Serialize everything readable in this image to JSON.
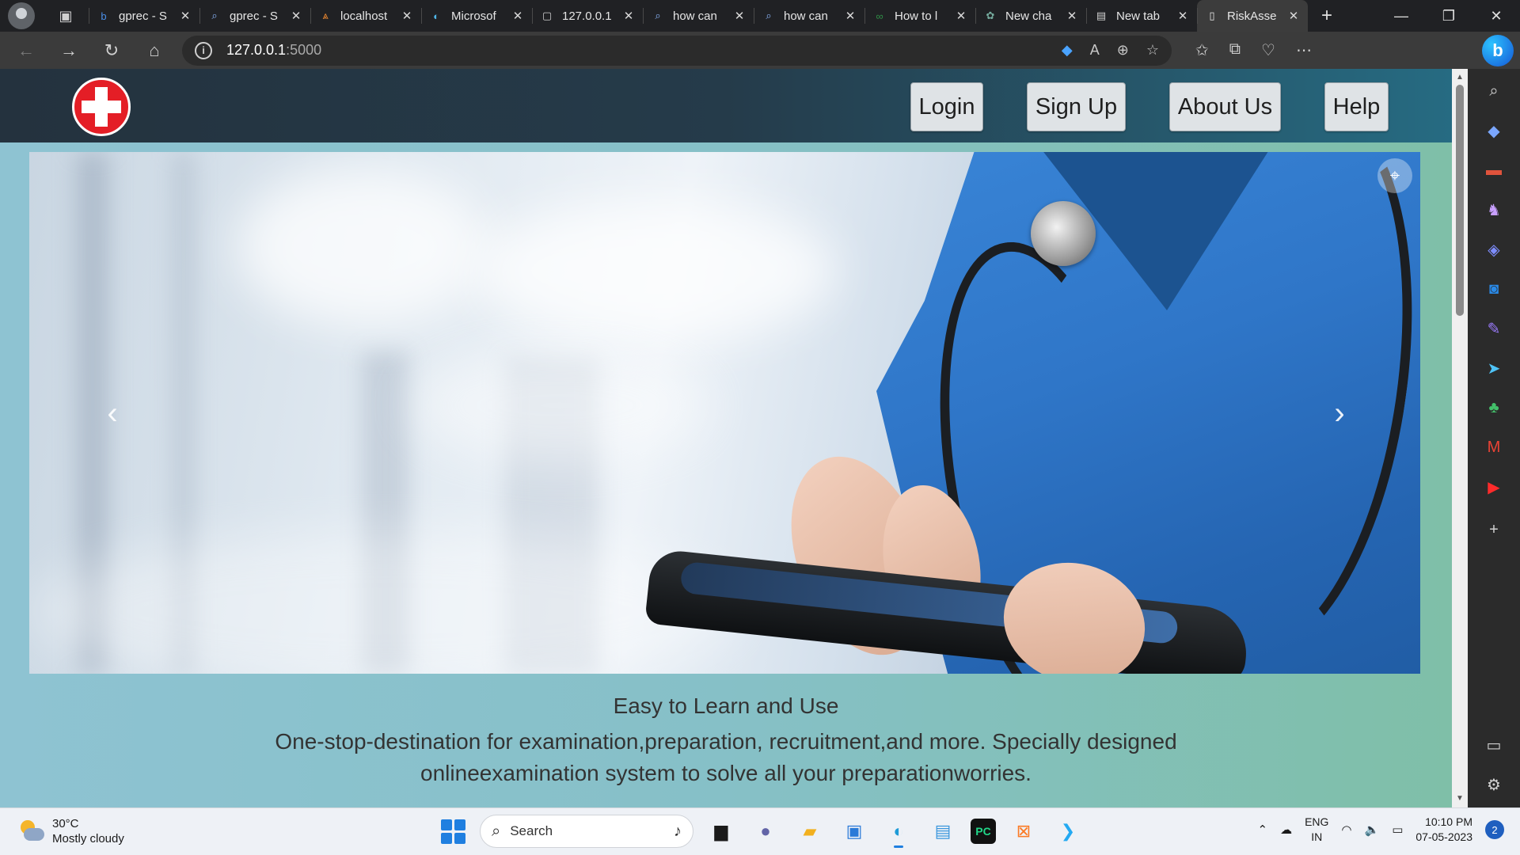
{
  "browser": {
    "tabs": [
      {
        "title": "gprec - S",
        "icon": "bing-icon",
        "glyph": "b",
        "color": "#4a8fe8",
        "active": false
      },
      {
        "title": "gprec - S",
        "icon": "search-icon",
        "glyph": "⌕",
        "color": "#8ab4f8",
        "active": false
      },
      {
        "title": "localhost",
        "icon": "xampp-icon",
        "glyph": "⩓",
        "color": "#f28b30",
        "active": false
      },
      {
        "title": "Microsof",
        "icon": "edge-icon",
        "glyph": "◐",
        "color": "#4fb6e8",
        "active": false
      },
      {
        "title": "127.0.0.1",
        "icon": "page-icon",
        "glyph": "▢",
        "color": "#d0d0d0",
        "active": false
      },
      {
        "title": "how can",
        "icon": "search-icon",
        "glyph": "⌕",
        "color": "#8ab4f8",
        "active": false
      },
      {
        "title": "how can",
        "icon": "search-icon",
        "glyph": "⌕",
        "color": "#8ab4f8",
        "active": false
      },
      {
        "title": "How to l",
        "icon": "gfg-icon",
        "glyph": "∞",
        "color": "#2f8d46",
        "active": false
      },
      {
        "title": "New cha",
        "icon": "chatgpt-icon",
        "glyph": "✿",
        "color": "#74aa9c",
        "active": false
      },
      {
        "title": "New tab",
        "icon": "newtab-icon",
        "glyph": "▤",
        "color": "#d0d0d0",
        "active": false
      },
      {
        "title": "RiskAsse",
        "icon": "document-icon",
        "glyph": "▯",
        "color": "#e8e8e8",
        "active": true
      }
    ],
    "url_host": "127.0.0.1",
    "url_port": ":5000"
  },
  "site": {
    "nav": {
      "login": "Login",
      "signup": "Sign Up",
      "about": "About Us",
      "help": "Help"
    },
    "tagline": "Easy to Learn and Use",
    "description": "One-stop-destination for examination,preparation, recruitment,and more. Specially designed onlineexamination system to solve all your preparationworries.",
    "colors": {
      "logo_red": "#e41e26",
      "header_dark": "#24323e"
    }
  },
  "taskbar": {
    "weather_temp": "30°C",
    "weather_desc": "Mostly cloudy",
    "search_label": "Search",
    "lang": "ENG",
    "region": "IN",
    "time": "10:10 PM",
    "date": "07-05-2023",
    "notifications": "2"
  }
}
